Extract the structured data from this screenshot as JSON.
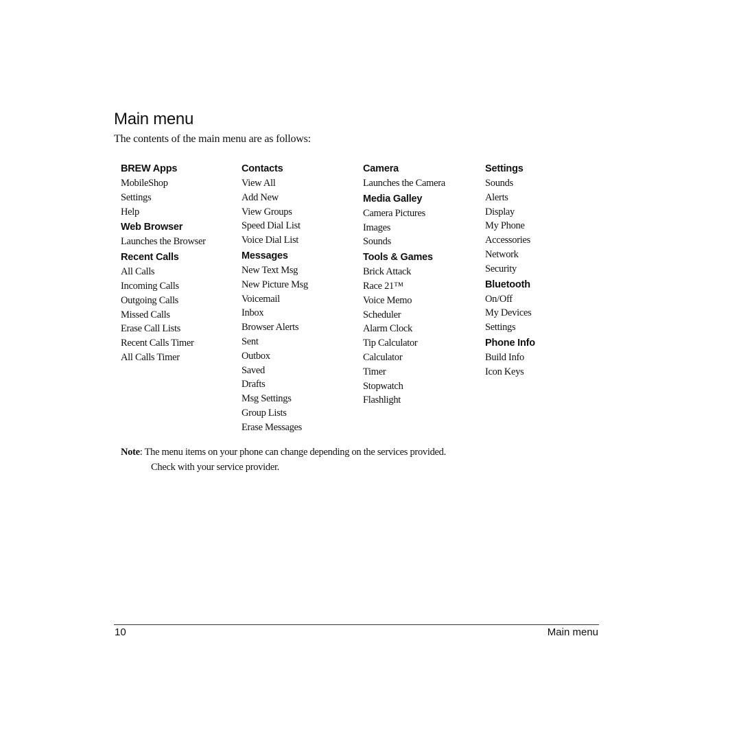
{
  "page": {
    "title": "Main menu",
    "intro": "The contents of the main menu are as follows:"
  },
  "columns": [
    {
      "groups": [
        {
          "heading": "BREW Apps",
          "items": [
            "MobileShop",
            "Settings",
            "Help"
          ]
        },
        {
          "heading": "Web Browser",
          "items": [
            "Launches the Browser"
          ]
        },
        {
          "heading": "Recent Calls",
          "items": [
            "All Calls",
            "Incoming Calls",
            "Outgoing Calls",
            "Missed Calls",
            "Erase Call Lists",
            "Recent Calls Timer",
            "All Calls Timer"
          ]
        }
      ]
    },
    {
      "groups": [
        {
          "heading": "Contacts",
          "items": [
            "View All",
            "Add New",
            "View Groups",
            "Speed Dial List",
            "Voice Dial List"
          ]
        },
        {
          "heading": "Messages",
          "items": [
            "New Text Msg",
            "New Picture Msg",
            "Voicemail",
            "Inbox",
            "Browser Alerts",
            "Sent",
            "Outbox",
            "Saved",
            "Drafts",
            "Msg Settings",
            "Group Lists",
            "Erase Messages"
          ]
        }
      ]
    },
    {
      "groups": [
        {
          "heading": "Camera",
          "items": [
            "Launches the Camera"
          ]
        },
        {
          "heading": "Media Galley",
          "items": [
            "Camera Pictures",
            "Images",
            "Sounds"
          ]
        },
        {
          "heading": "Tools & Games",
          "items": [
            "Brick Attack",
            "Race 21™",
            "Voice Memo",
            "Scheduler",
            "Alarm Clock",
            "Tip Calculator",
            "Calculator",
            "Timer",
            "Stopwatch",
            "Flashlight"
          ]
        }
      ]
    },
    {
      "groups": [
        {
          "heading": "Settings",
          "items": [
            "Sounds",
            "Alerts",
            "Display",
            "My Phone",
            "Accessories",
            "Network",
            "Security"
          ]
        },
        {
          "heading": "Bluetooth",
          "items": [
            "On/Off",
            "My Devices",
            "Settings"
          ]
        },
        {
          "heading": "Phone Info",
          "items": [
            "Build Info",
            "Icon Keys"
          ]
        }
      ]
    }
  ],
  "note": {
    "label": "Note",
    "line1": ": The menu items on your phone can change depending on the services provided.",
    "line2": "Check with your service provider."
  },
  "footer": {
    "page_number": "10",
    "section": "Main menu"
  }
}
